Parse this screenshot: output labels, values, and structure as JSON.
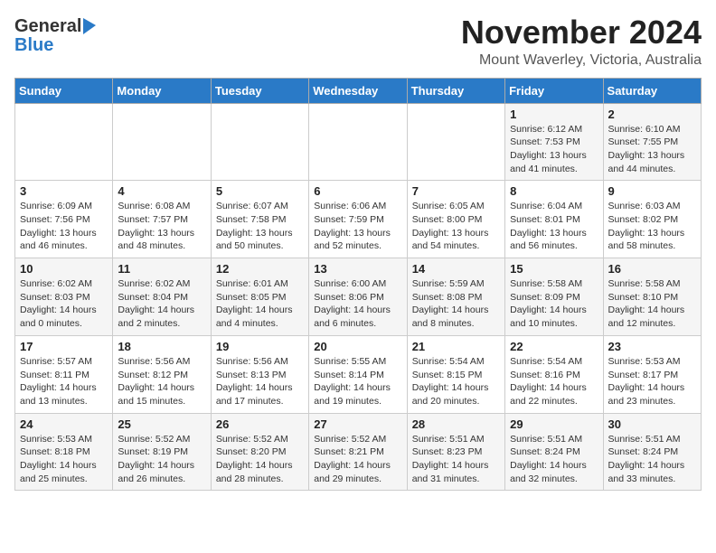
{
  "header": {
    "logo_general": "General",
    "logo_blue": "Blue",
    "month": "November 2024",
    "location": "Mount Waverley, Victoria, Australia"
  },
  "weekdays": [
    "Sunday",
    "Monday",
    "Tuesday",
    "Wednesday",
    "Thursday",
    "Friday",
    "Saturday"
  ],
  "weeks": [
    [
      {
        "day": "",
        "info": ""
      },
      {
        "day": "",
        "info": ""
      },
      {
        "day": "",
        "info": ""
      },
      {
        "day": "",
        "info": ""
      },
      {
        "day": "",
        "info": ""
      },
      {
        "day": "1",
        "info": "Sunrise: 6:12 AM\nSunset: 7:53 PM\nDaylight: 13 hours\nand 41 minutes."
      },
      {
        "day": "2",
        "info": "Sunrise: 6:10 AM\nSunset: 7:55 PM\nDaylight: 13 hours\nand 44 minutes."
      }
    ],
    [
      {
        "day": "3",
        "info": "Sunrise: 6:09 AM\nSunset: 7:56 PM\nDaylight: 13 hours\nand 46 minutes."
      },
      {
        "day": "4",
        "info": "Sunrise: 6:08 AM\nSunset: 7:57 PM\nDaylight: 13 hours\nand 48 minutes."
      },
      {
        "day": "5",
        "info": "Sunrise: 6:07 AM\nSunset: 7:58 PM\nDaylight: 13 hours\nand 50 minutes."
      },
      {
        "day": "6",
        "info": "Sunrise: 6:06 AM\nSunset: 7:59 PM\nDaylight: 13 hours\nand 52 minutes."
      },
      {
        "day": "7",
        "info": "Sunrise: 6:05 AM\nSunset: 8:00 PM\nDaylight: 13 hours\nand 54 minutes."
      },
      {
        "day": "8",
        "info": "Sunrise: 6:04 AM\nSunset: 8:01 PM\nDaylight: 13 hours\nand 56 minutes."
      },
      {
        "day": "9",
        "info": "Sunrise: 6:03 AM\nSunset: 8:02 PM\nDaylight: 13 hours\nand 58 minutes."
      }
    ],
    [
      {
        "day": "10",
        "info": "Sunrise: 6:02 AM\nSunset: 8:03 PM\nDaylight: 14 hours\nand 0 minutes."
      },
      {
        "day": "11",
        "info": "Sunrise: 6:02 AM\nSunset: 8:04 PM\nDaylight: 14 hours\nand 2 minutes."
      },
      {
        "day": "12",
        "info": "Sunrise: 6:01 AM\nSunset: 8:05 PM\nDaylight: 14 hours\nand 4 minutes."
      },
      {
        "day": "13",
        "info": "Sunrise: 6:00 AM\nSunset: 8:06 PM\nDaylight: 14 hours\nand 6 minutes."
      },
      {
        "day": "14",
        "info": "Sunrise: 5:59 AM\nSunset: 8:08 PM\nDaylight: 14 hours\nand 8 minutes."
      },
      {
        "day": "15",
        "info": "Sunrise: 5:58 AM\nSunset: 8:09 PM\nDaylight: 14 hours\nand 10 minutes."
      },
      {
        "day": "16",
        "info": "Sunrise: 5:58 AM\nSunset: 8:10 PM\nDaylight: 14 hours\nand 12 minutes."
      }
    ],
    [
      {
        "day": "17",
        "info": "Sunrise: 5:57 AM\nSunset: 8:11 PM\nDaylight: 14 hours\nand 13 minutes."
      },
      {
        "day": "18",
        "info": "Sunrise: 5:56 AM\nSunset: 8:12 PM\nDaylight: 14 hours\nand 15 minutes."
      },
      {
        "day": "19",
        "info": "Sunrise: 5:56 AM\nSunset: 8:13 PM\nDaylight: 14 hours\nand 17 minutes."
      },
      {
        "day": "20",
        "info": "Sunrise: 5:55 AM\nSunset: 8:14 PM\nDaylight: 14 hours\nand 19 minutes."
      },
      {
        "day": "21",
        "info": "Sunrise: 5:54 AM\nSunset: 8:15 PM\nDaylight: 14 hours\nand 20 minutes."
      },
      {
        "day": "22",
        "info": "Sunrise: 5:54 AM\nSunset: 8:16 PM\nDaylight: 14 hours\nand 22 minutes."
      },
      {
        "day": "23",
        "info": "Sunrise: 5:53 AM\nSunset: 8:17 PM\nDaylight: 14 hours\nand 23 minutes."
      }
    ],
    [
      {
        "day": "24",
        "info": "Sunrise: 5:53 AM\nSunset: 8:18 PM\nDaylight: 14 hours\nand 25 minutes."
      },
      {
        "day": "25",
        "info": "Sunrise: 5:52 AM\nSunset: 8:19 PM\nDaylight: 14 hours\nand 26 minutes."
      },
      {
        "day": "26",
        "info": "Sunrise: 5:52 AM\nSunset: 8:20 PM\nDaylight: 14 hours\nand 28 minutes."
      },
      {
        "day": "27",
        "info": "Sunrise: 5:52 AM\nSunset: 8:21 PM\nDaylight: 14 hours\nand 29 minutes."
      },
      {
        "day": "28",
        "info": "Sunrise: 5:51 AM\nSunset: 8:23 PM\nDaylight: 14 hours\nand 31 minutes."
      },
      {
        "day": "29",
        "info": "Sunrise: 5:51 AM\nSunset: 8:24 PM\nDaylight: 14 hours\nand 32 minutes."
      },
      {
        "day": "30",
        "info": "Sunrise: 5:51 AM\nSunset: 8:24 PM\nDaylight: 14 hours\nand 33 minutes."
      }
    ]
  ]
}
